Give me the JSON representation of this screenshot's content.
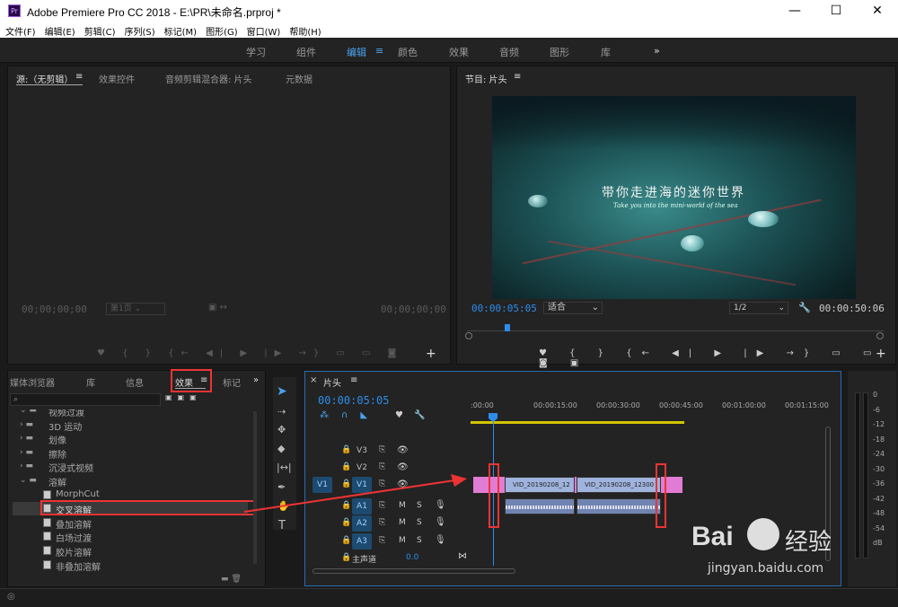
{
  "window": {
    "title": "Adobe Premiere Pro CC 2018 - E:\\PR\\未命名.prproj *",
    "app_icon": "Pr",
    "minimize": "—",
    "maximize": "☐",
    "close": "✕"
  },
  "menu": [
    "文件(F)",
    "编辑(E)",
    "剪辑(C)",
    "序列(S)",
    "标记(M)",
    "图形(G)",
    "窗口(W)",
    "帮助(H)"
  ],
  "workspaces": [
    "学习",
    "组件",
    "编辑",
    "颜色",
    "效果",
    "音频",
    "图形",
    "库"
  ],
  "workspace_active": "编辑",
  "workspace_more": "»",
  "source_panel": {
    "tabs": [
      "源:（无剪辑）",
      "效果控件",
      "音频剪辑混合器: 片头",
      "元数据"
    ],
    "tc_left": "00;00;00;00",
    "tc_right": "00;00;00;00",
    "page": "第1页"
  },
  "program_panel": {
    "title": "节目: 片头",
    "caption_cn": "带你走进海的迷你世界",
    "caption_en": "Take you into the mini-world of the sea",
    "tc_current": "00:00:05:05",
    "fit": "适合",
    "resolution": "1/2",
    "tc_duration": "00:00:50:06"
  },
  "project_panel": {
    "tabs": [
      "媒体浏览器",
      "库",
      "信息",
      "效果",
      "标记"
    ],
    "active_tab": "效果",
    "more": "»"
  },
  "effects_tree": [
    {
      "label": "视频过渡",
      "type": "folder-open",
      "level": 0
    },
    {
      "label": "3D 运动",
      "type": "folder",
      "level": 0
    },
    {
      "label": "划像",
      "type": "folder",
      "level": 0
    },
    {
      "label": "擦除",
      "type": "folder",
      "level": 0
    },
    {
      "label": "沉浸式视频",
      "type": "folder",
      "level": 0
    },
    {
      "label": "溶解",
      "type": "folder-open",
      "level": 0
    },
    {
      "label": "MorphCut",
      "type": "fx",
      "level": 1
    },
    {
      "label": "交叉溶解",
      "type": "fx",
      "level": 1,
      "selected": true
    },
    {
      "label": "叠加溶解",
      "type": "fx",
      "level": 1
    },
    {
      "label": "白场过渡",
      "type": "fx",
      "level": 1
    },
    {
      "label": "胶片溶解",
      "type": "fx",
      "level": 1
    },
    {
      "label": "非叠加溶解",
      "type": "fx",
      "level": 1
    }
  ],
  "timeline": {
    "sequence": "片头",
    "tc": "00:00:05:05",
    "ruler": [
      ":00:00",
      "00:00:15:00",
      "00:00:30:00",
      "00:00:45:00",
      "00:01:00:00",
      "00:01:15:00"
    ],
    "video_tracks": [
      "V3",
      "V2",
      "V1"
    ],
    "audio_tracks": [
      "A1",
      "A2",
      "A3"
    ],
    "source_v": "V1",
    "master": "主声道",
    "master_val": "0.0",
    "clips": [
      "VID_20190208_12",
      "VID_20190208_12300"
    ]
  },
  "meter": [
    "0",
    "-6",
    "-12",
    "-18",
    "-24",
    "-30",
    "-36",
    "-42",
    "-48",
    "-54",
    "dB"
  ],
  "watermark": {
    "brand": "Bai",
    "brand2": "经验",
    "url": "jingyan.baidu.com"
  }
}
